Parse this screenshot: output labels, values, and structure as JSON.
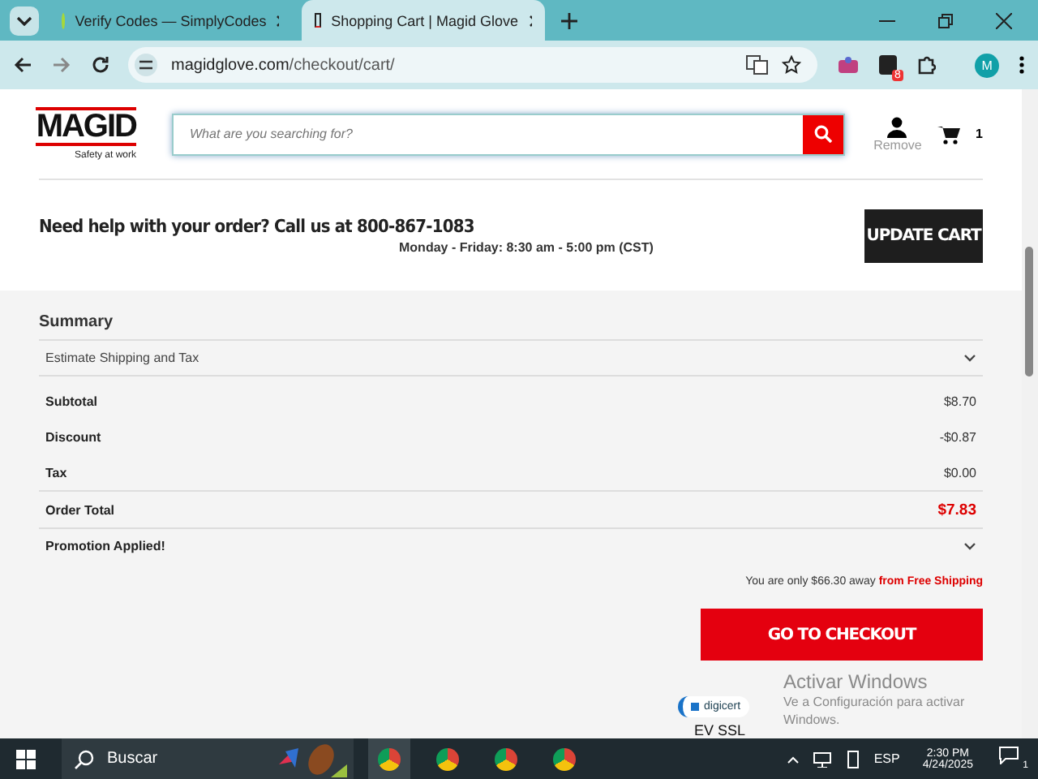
{
  "browser": {
    "tabs": [
      {
        "title": "Verify Codes — SimplyCodes",
        "selected": false
      },
      {
        "title": "Shopping Cart | Magid Glove",
        "selected": true
      }
    ],
    "url_host": "magidglove.com",
    "url_path": "/checkout/cart/",
    "profile_initial": "M",
    "extension_badge": "8"
  },
  "header": {
    "logo": "MAGID",
    "tagline": "Safety at work",
    "search": {
      "placeholder": "What are you searching for?"
    },
    "remove_label": "Remove",
    "cart_count": "1"
  },
  "help": {
    "heading": "Need help with your order? Call us at 800-867-1083",
    "hours": "Monday - Friday: 8:30 am - 5:00 pm (CST)",
    "update_button": "UPDATE CART"
  },
  "summary": {
    "title": "Summary",
    "estimate": {
      "label": "Estimate Shipping and Tax",
      "expanded": false
    },
    "rows": [
      {
        "label": "Subtotal",
        "value": "$8.70",
        "kind": "plain"
      },
      {
        "label": "Discount",
        "value": "-$0.87",
        "kind": "plain"
      },
      {
        "label": "Tax",
        "value": "$0.00",
        "kind": "plain"
      },
      {
        "label": "Order Total",
        "value": "$7.83",
        "kind": "total"
      }
    ],
    "promotion": {
      "label": "Promotion Applied!",
      "expanded": false
    },
    "shipping_note": "You are only $66.30 away",
    "shipping_link": "from Free Shipping",
    "checkout_button": "GO TO CHECKOUT",
    "seal": "digicert",
    "seal_caption": "EV SSL"
  },
  "activation": {
    "title": "Activar Windows",
    "text": "Ve a Configuración para activar Windows."
  },
  "taskbar": {
    "search": "Buscar",
    "language": "ESP",
    "time": "2:30 PM",
    "date": "4/24/2025",
    "notifications": "1"
  }
}
